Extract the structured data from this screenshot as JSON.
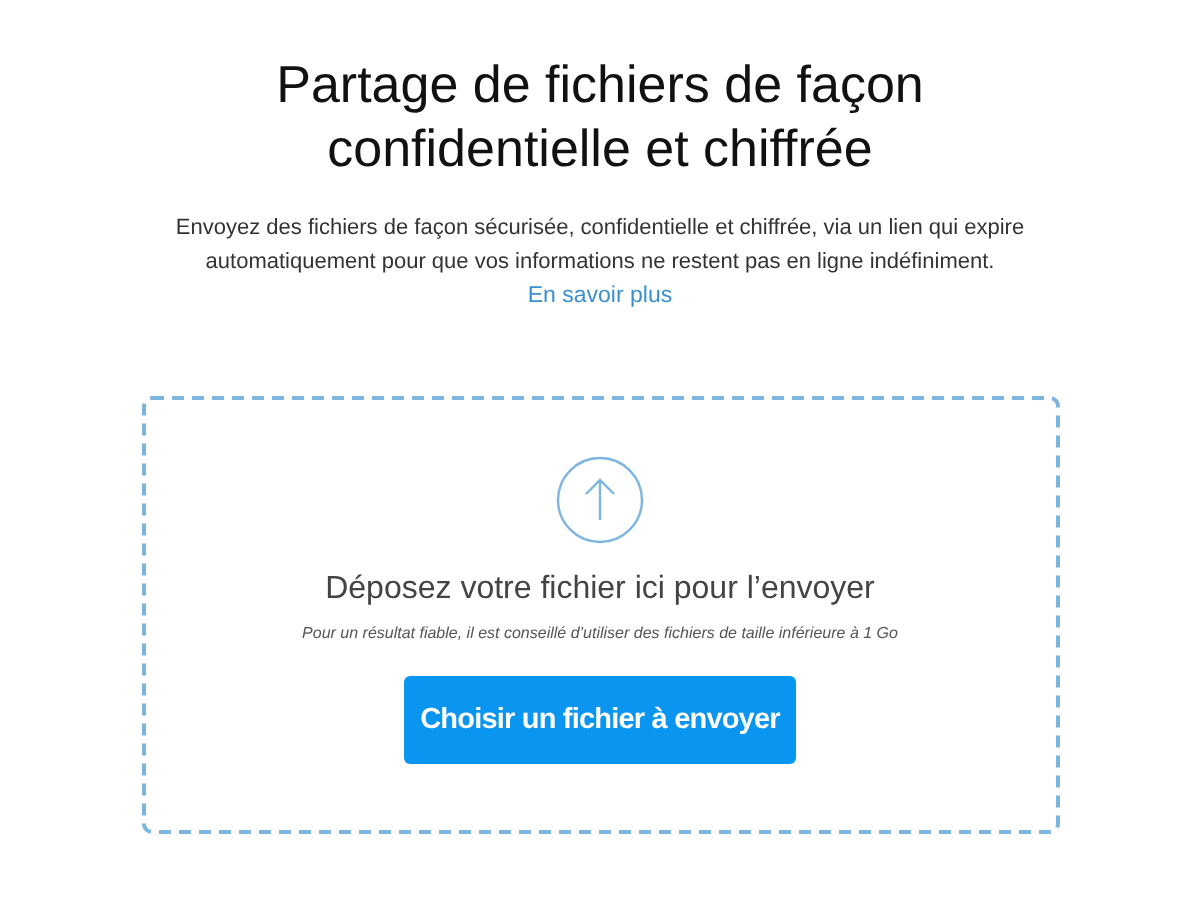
{
  "heading": "Partage de fichiers de façon confidentielle et chiffrée",
  "description": "Envoyez des fichiers de façon sécurisée, confidentielle et chiffrée, via un lien qui expire automatiquement pour que vos informations ne restent pas en ligne indéfiniment.",
  "learn_more_link": "En savoir plus",
  "dropzone": {
    "title": "Déposez votre fichier ici pour l’envoyer",
    "hint": "Pour un résultat fiable, il est conseillé d’utiliser des fichiers de taille inférieure à 1 Go",
    "button": "Choisir un fichier à envoyer"
  }
}
